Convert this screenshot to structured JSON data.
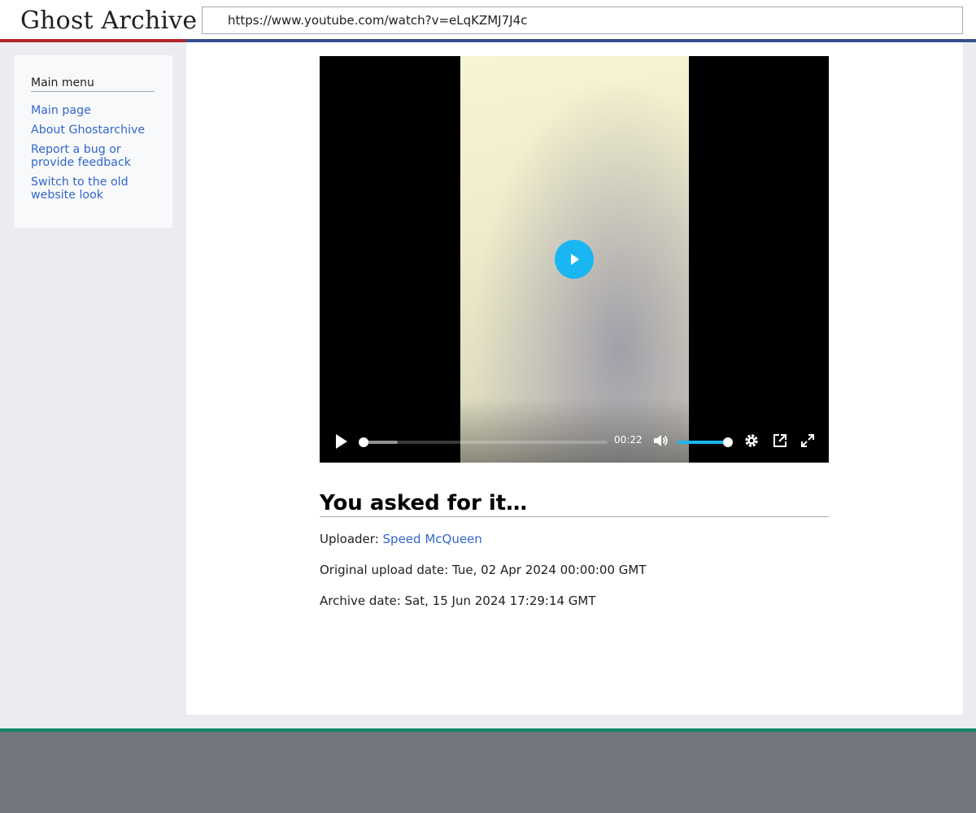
{
  "header": {
    "logo_text": "Ghost Archive",
    "url": "https://www.youtube.com/watch?v=eLqKZMJ7J4c"
  },
  "sidebar": {
    "heading": "Main menu",
    "items": [
      {
        "label": "Main page"
      },
      {
        "label": "About Ghostarchive"
      },
      {
        "label": "Report a bug or provide feedback"
      },
      {
        "label": "Switch to the old website look"
      }
    ]
  },
  "video": {
    "time_display": "00:22",
    "playback_progress": 0.0,
    "buffered_fraction": 0.14,
    "volume_level": 1.0,
    "icons": [
      "play-icon",
      "volume-icon",
      "settings-gear-icon",
      "picture-in-picture-icon",
      "fullscreen-icon"
    ],
    "accent_color": "#1ab6f4"
  },
  "page": {
    "title": "You asked for it…",
    "uploader_label": "Uploader:",
    "uploader_name": "Speed McQueen",
    "upload_date_text": "Original upload date: Tue, 02 Apr 2024 00:00:00 GMT",
    "archive_date_text": "Archive date: Sat, 15 Jun 2024 17:29:14 GMT"
  },
  "colors": {
    "logo_underline": "#b32424",
    "header_underline": "#36508d",
    "link": "#3366cc",
    "footer_line": "#14866d",
    "footer": "#72777d"
  }
}
